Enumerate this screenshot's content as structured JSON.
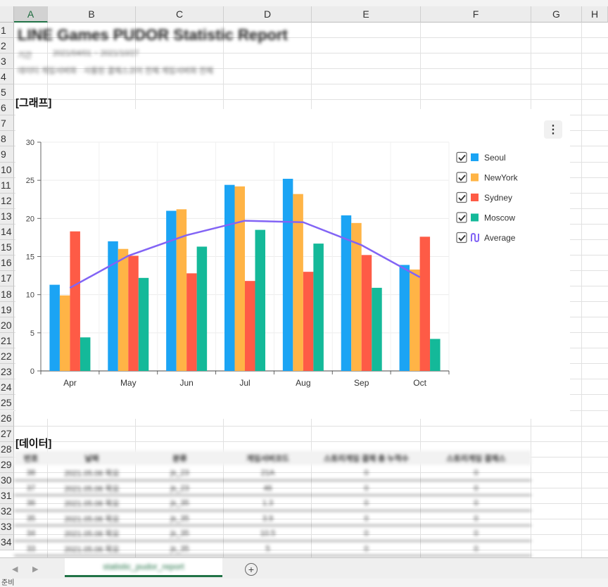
{
  "columns": [
    "A",
    "B",
    "C",
    "D",
    "E",
    "F",
    "G",
    "H"
  ],
  "rows": [
    "1",
    "2",
    "3",
    "4",
    "5",
    "6",
    "7",
    "8",
    "9",
    "10",
    "11",
    "12",
    "13",
    "14",
    "15",
    "16",
    "17",
    "18",
    "19",
    "20",
    "21",
    "22",
    "23",
    "24",
    "25",
    "26",
    "27",
    "28",
    "29",
    "30",
    "31",
    "32",
    "33",
    "34"
  ],
  "report": {
    "title": "LINE Games PUDOR Statistic Report",
    "period_label": "기간",
    "period": "2021/04/01 ~ 2021/10/27",
    "description": "데이터 게임서버와 · 사용된 결제스코어 전체 게임서버와 전체"
  },
  "sections": {
    "graph_label": "[그래프]",
    "data_label": "[데이터]"
  },
  "chart_menu_icon": "⋮",
  "chart_data": {
    "type": "bar",
    "categories": [
      "Apr",
      "May",
      "Jun",
      "Jul",
      "Aug",
      "Sep",
      "Oct"
    ],
    "ylim": [
      0,
      30
    ],
    "yticks": [
      0,
      5,
      10,
      15,
      20,
      25,
      30
    ],
    "grid": true,
    "legend_position": "right",
    "series": [
      {
        "name": "Seoul",
        "type": "bar",
        "color": "#1ba4f4",
        "values": [
          11.3,
          17.0,
          21.0,
          24.4,
          25.2,
          20.4,
          13.9
        ]
      },
      {
        "name": "NewYork",
        "type": "bar",
        "color": "#ffb446",
        "values": [
          9.9,
          16.0,
          21.2,
          24.2,
          23.2,
          19.4,
          13.3
        ]
      },
      {
        "name": "Sydney",
        "type": "bar",
        "color": "#fe5b46",
        "values": [
          18.3,
          15.1,
          12.8,
          11.8,
          13.0,
          15.2,
          17.6
        ]
      },
      {
        "name": "Moscow",
        "type": "bar",
        "color": "#14b999",
        "values": [
          4.4,
          12.2,
          16.3,
          18.5,
          16.7,
          10.9,
          4.2
        ]
      },
      {
        "name": "Average",
        "type": "line",
        "color": "#8264f5",
        "values": [
          10.9,
          15.1,
          17.8,
          19.7,
          19.5,
          16.5,
          12.3
        ]
      }
    ]
  },
  "table": {
    "headers": [
      "번호",
      "날짜",
      "분류",
      "게임서버코드",
      "스토리게임 결제 총 누적수",
      "스토리게임 결제스"
    ],
    "rows": [
      [
        "38",
        "2021.05.06 목요",
        "js_23",
        "21A",
        "0",
        "0"
      ],
      [
        "37",
        "2021.05.06 목요",
        "js_23",
        "46",
        "0",
        "0"
      ],
      [
        "36",
        "2021.05.06 목요",
        "js_35",
        "1.3",
        "0",
        "0"
      ],
      [
        "35",
        "2021.05.06 목요",
        "js_35",
        "3.9",
        "0",
        "0"
      ],
      [
        "34",
        "2021.05.06 목요",
        "js_35",
        "10.5",
        "0",
        "0"
      ],
      [
        "33",
        "2021.05.06 목요",
        "js_35",
        "5",
        "0",
        "0"
      ]
    ]
  },
  "tabbar": {
    "prev_icon": "◀",
    "next_icon": "▶",
    "sheet_name": "statistic_pudor_report",
    "add_icon": "+"
  },
  "status": "준비"
}
